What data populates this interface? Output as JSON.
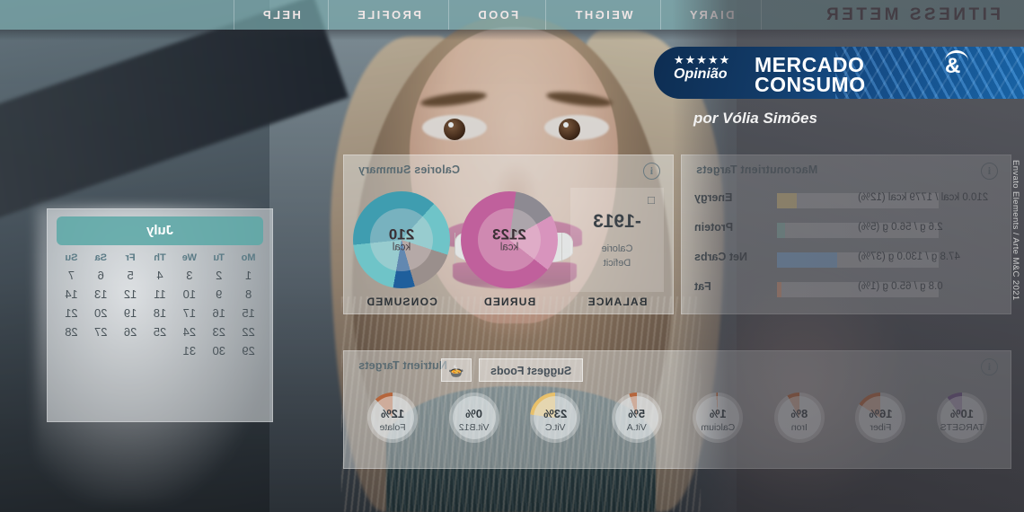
{
  "app": {
    "title": "FITNESS METER",
    "nav": [
      "DIARY",
      "WEIGHT",
      "FOOD",
      "PROFILE",
      "HELP"
    ]
  },
  "macro_card": {
    "title": "Macronutrient Targets",
    "info_icon": "i",
    "rows": [
      {
        "label": "Energy",
        "value": "210.0 kcal / 1779 kcal (12%)",
        "pct": 12,
        "color": "#e8d49a"
      },
      {
        "label": "Protein",
        "value": "2.6 g / 56.0 g (5%)",
        "pct": 5,
        "color": "#9dc6bf"
      },
      {
        "label": "Net Carbs",
        "value": "47.8 g / 130.0 g (37%)",
        "pct": 37,
        "color": "#8fb9e0"
      },
      {
        "label": "Fat",
        "value": "0.8 g / 65.0 g (1%)",
        "pct": 1,
        "color": "#e0a98c"
      }
    ]
  },
  "calories_card": {
    "title": "Calories Summary",
    "info_icon": "i",
    "lock_icon": "□",
    "balance": {
      "caption": "BALANCE",
      "value": "-1913",
      "sub_line1": "Calorie",
      "sub_line2": "Deficit"
    },
    "burned": {
      "caption": "BURNED",
      "value": "2123",
      "unit": "kcal",
      "ring_color": "#c0609c",
      "ring_color_2": "#d894bd",
      "ring_track": "#8d8a92"
    },
    "consumed": {
      "caption": "CONSUMED",
      "value": "210",
      "unit": "kcal",
      "ring_color": "#3f9db0",
      "ring_color_2": "#6fc4c8",
      "ring_color_3": "#1f5f9c",
      "ring_track": "#9a8f8c"
    }
  },
  "nutrient_card": {
    "title": "Nutrient Targets",
    "info_icon": "i",
    "suggest_label": "Suggest Foods",
    "suggest_icon": "food-bowl-icon",
    "items": [
      {
        "name": "TARGETS",
        "pct": "10%",
        "value": 10,
        "color": "#6b4f86"
      },
      {
        "name": "Fiber",
        "pct": "16%",
        "value": 16,
        "color": "#b5653c"
      },
      {
        "name": "Iron",
        "pct": "8%",
        "value": 8,
        "color": "#b5653c"
      },
      {
        "name": "Calcium",
        "pct": "1%",
        "value": 1,
        "color": "#b5653c"
      },
      {
        "name": "Vit.A",
        "pct": "5%",
        "value": 5,
        "color": "#b5653c"
      },
      {
        "name": "Vit.C",
        "pct": "23%",
        "value": 23,
        "color": "#e8c06a"
      },
      {
        "name": "Vit.B12",
        "pct": "0%",
        "value": 0,
        "color": "#b5653c"
      },
      {
        "name": "Folate",
        "pct": "12%",
        "value": 12,
        "color": "#b5653c"
      }
    ]
  },
  "calendar": {
    "month": "July",
    "weekdays": [
      "Mo",
      "Tu",
      "We",
      "Th",
      "Fr",
      "Sa",
      "Su"
    ],
    "weeks": [
      [
        "1",
        "2",
        "3",
        "4",
        "5",
        "6",
        "7"
      ],
      [
        "8",
        "9",
        "10",
        "11",
        "12",
        "13",
        "14"
      ],
      [
        "15",
        "16",
        "17",
        "18",
        "19",
        "20",
        "21"
      ],
      [
        "22",
        "23",
        "24",
        "25",
        "26",
        "27",
        "28"
      ],
      [
        "29",
        "30",
        "31",
        "",
        "",
        "",
        ""
      ]
    ]
  },
  "branding": {
    "stars": "★★★★★",
    "opinion_label": "Opinião",
    "logo_line1": "MERCADO",
    "logo_line2": "CONSUMO",
    "logo_amp": "&",
    "byline": "por Vólia Simões",
    "credit": "Envato Elements / Arte M&C 2021",
    "accent_blue": "#16508c",
    "accent_teal": "#5ca8a7"
  }
}
